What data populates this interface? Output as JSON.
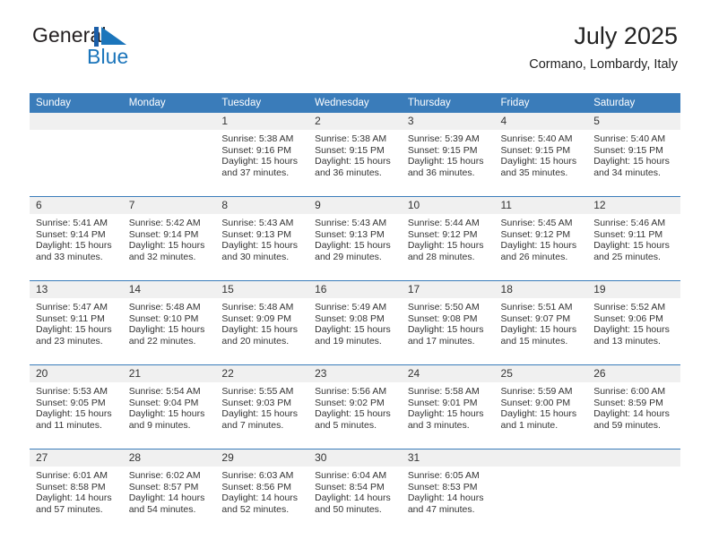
{
  "brand": {
    "name_part1": "General",
    "name_part2": "Blue",
    "logo_icon": "triangle-flag-icon",
    "accent_color": "#1b75bb"
  },
  "header": {
    "title": "July 2025",
    "subtitle": "Cormano, Lombardy, Italy"
  },
  "theme": {
    "header_blue": "#3a7cba",
    "date_band_grey": "#f0f0f0",
    "text_color": "#333333"
  },
  "weekdays": [
    "Sunday",
    "Monday",
    "Tuesday",
    "Wednesday",
    "Thursday",
    "Friday",
    "Saturday"
  ],
  "weeks": [
    {
      "days": [
        {
          "num": "",
          "lines": []
        },
        {
          "num": "",
          "lines": []
        },
        {
          "num": "1",
          "lines": [
            "Sunrise: 5:38 AM",
            "Sunset: 9:16 PM",
            "Daylight: 15 hours",
            "and 37 minutes."
          ]
        },
        {
          "num": "2",
          "lines": [
            "Sunrise: 5:38 AM",
            "Sunset: 9:15 PM",
            "Daylight: 15 hours",
            "and 36 minutes."
          ]
        },
        {
          "num": "3",
          "lines": [
            "Sunrise: 5:39 AM",
            "Sunset: 9:15 PM",
            "Daylight: 15 hours",
            "and 36 minutes."
          ]
        },
        {
          "num": "4",
          "lines": [
            "Sunrise: 5:40 AM",
            "Sunset: 9:15 PM",
            "Daylight: 15 hours",
            "and 35 minutes."
          ]
        },
        {
          "num": "5",
          "lines": [
            "Sunrise: 5:40 AM",
            "Sunset: 9:15 PM",
            "Daylight: 15 hours",
            "and 34 minutes."
          ]
        }
      ]
    },
    {
      "days": [
        {
          "num": "6",
          "lines": [
            "Sunrise: 5:41 AM",
            "Sunset: 9:14 PM",
            "Daylight: 15 hours",
            "and 33 minutes."
          ]
        },
        {
          "num": "7",
          "lines": [
            "Sunrise: 5:42 AM",
            "Sunset: 9:14 PM",
            "Daylight: 15 hours",
            "and 32 minutes."
          ]
        },
        {
          "num": "8",
          "lines": [
            "Sunrise: 5:43 AM",
            "Sunset: 9:13 PM",
            "Daylight: 15 hours",
            "and 30 minutes."
          ]
        },
        {
          "num": "9",
          "lines": [
            "Sunrise: 5:43 AM",
            "Sunset: 9:13 PM",
            "Daylight: 15 hours",
            "and 29 minutes."
          ]
        },
        {
          "num": "10",
          "lines": [
            "Sunrise: 5:44 AM",
            "Sunset: 9:12 PM",
            "Daylight: 15 hours",
            "and 28 minutes."
          ]
        },
        {
          "num": "11",
          "lines": [
            "Sunrise: 5:45 AM",
            "Sunset: 9:12 PM",
            "Daylight: 15 hours",
            "and 26 minutes."
          ]
        },
        {
          "num": "12",
          "lines": [
            "Sunrise: 5:46 AM",
            "Sunset: 9:11 PM",
            "Daylight: 15 hours",
            "and 25 minutes."
          ]
        }
      ]
    },
    {
      "days": [
        {
          "num": "13",
          "lines": [
            "Sunrise: 5:47 AM",
            "Sunset: 9:11 PM",
            "Daylight: 15 hours",
            "and 23 minutes."
          ]
        },
        {
          "num": "14",
          "lines": [
            "Sunrise: 5:48 AM",
            "Sunset: 9:10 PM",
            "Daylight: 15 hours",
            "and 22 minutes."
          ]
        },
        {
          "num": "15",
          "lines": [
            "Sunrise: 5:48 AM",
            "Sunset: 9:09 PM",
            "Daylight: 15 hours",
            "and 20 minutes."
          ]
        },
        {
          "num": "16",
          "lines": [
            "Sunrise: 5:49 AM",
            "Sunset: 9:08 PM",
            "Daylight: 15 hours",
            "and 19 minutes."
          ]
        },
        {
          "num": "17",
          "lines": [
            "Sunrise: 5:50 AM",
            "Sunset: 9:08 PM",
            "Daylight: 15 hours",
            "and 17 minutes."
          ]
        },
        {
          "num": "18",
          "lines": [
            "Sunrise: 5:51 AM",
            "Sunset: 9:07 PM",
            "Daylight: 15 hours",
            "and 15 minutes."
          ]
        },
        {
          "num": "19",
          "lines": [
            "Sunrise: 5:52 AM",
            "Sunset: 9:06 PM",
            "Daylight: 15 hours",
            "and 13 minutes."
          ]
        }
      ]
    },
    {
      "days": [
        {
          "num": "20",
          "lines": [
            "Sunrise: 5:53 AM",
            "Sunset: 9:05 PM",
            "Daylight: 15 hours",
            "and 11 minutes."
          ]
        },
        {
          "num": "21",
          "lines": [
            "Sunrise: 5:54 AM",
            "Sunset: 9:04 PM",
            "Daylight: 15 hours",
            "and 9 minutes."
          ]
        },
        {
          "num": "22",
          "lines": [
            "Sunrise: 5:55 AM",
            "Sunset: 9:03 PM",
            "Daylight: 15 hours",
            "and 7 minutes."
          ]
        },
        {
          "num": "23",
          "lines": [
            "Sunrise: 5:56 AM",
            "Sunset: 9:02 PM",
            "Daylight: 15 hours",
            "and 5 minutes."
          ]
        },
        {
          "num": "24",
          "lines": [
            "Sunrise: 5:58 AM",
            "Sunset: 9:01 PM",
            "Daylight: 15 hours",
            "and 3 minutes."
          ]
        },
        {
          "num": "25",
          "lines": [
            "Sunrise: 5:59 AM",
            "Sunset: 9:00 PM",
            "Daylight: 15 hours",
            "and 1 minute."
          ]
        },
        {
          "num": "26",
          "lines": [
            "Sunrise: 6:00 AM",
            "Sunset: 8:59 PM",
            "Daylight: 14 hours",
            "and 59 minutes."
          ]
        }
      ]
    },
    {
      "days": [
        {
          "num": "27",
          "lines": [
            "Sunrise: 6:01 AM",
            "Sunset: 8:58 PM",
            "Daylight: 14 hours",
            "and 57 minutes."
          ]
        },
        {
          "num": "28",
          "lines": [
            "Sunrise: 6:02 AM",
            "Sunset: 8:57 PM",
            "Daylight: 14 hours",
            "and 54 minutes."
          ]
        },
        {
          "num": "29",
          "lines": [
            "Sunrise: 6:03 AM",
            "Sunset: 8:56 PM",
            "Daylight: 14 hours",
            "and 52 minutes."
          ]
        },
        {
          "num": "30",
          "lines": [
            "Sunrise: 6:04 AM",
            "Sunset: 8:54 PM",
            "Daylight: 14 hours",
            "and 50 minutes."
          ]
        },
        {
          "num": "31",
          "lines": [
            "Sunrise: 6:05 AM",
            "Sunset: 8:53 PM",
            "Daylight: 14 hours",
            "and 47 minutes."
          ]
        },
        {
          "num": "",
          "lines": []
        },
        {
          "num": "",
          "lines": []
        }
      ]
    }
  ]
}
